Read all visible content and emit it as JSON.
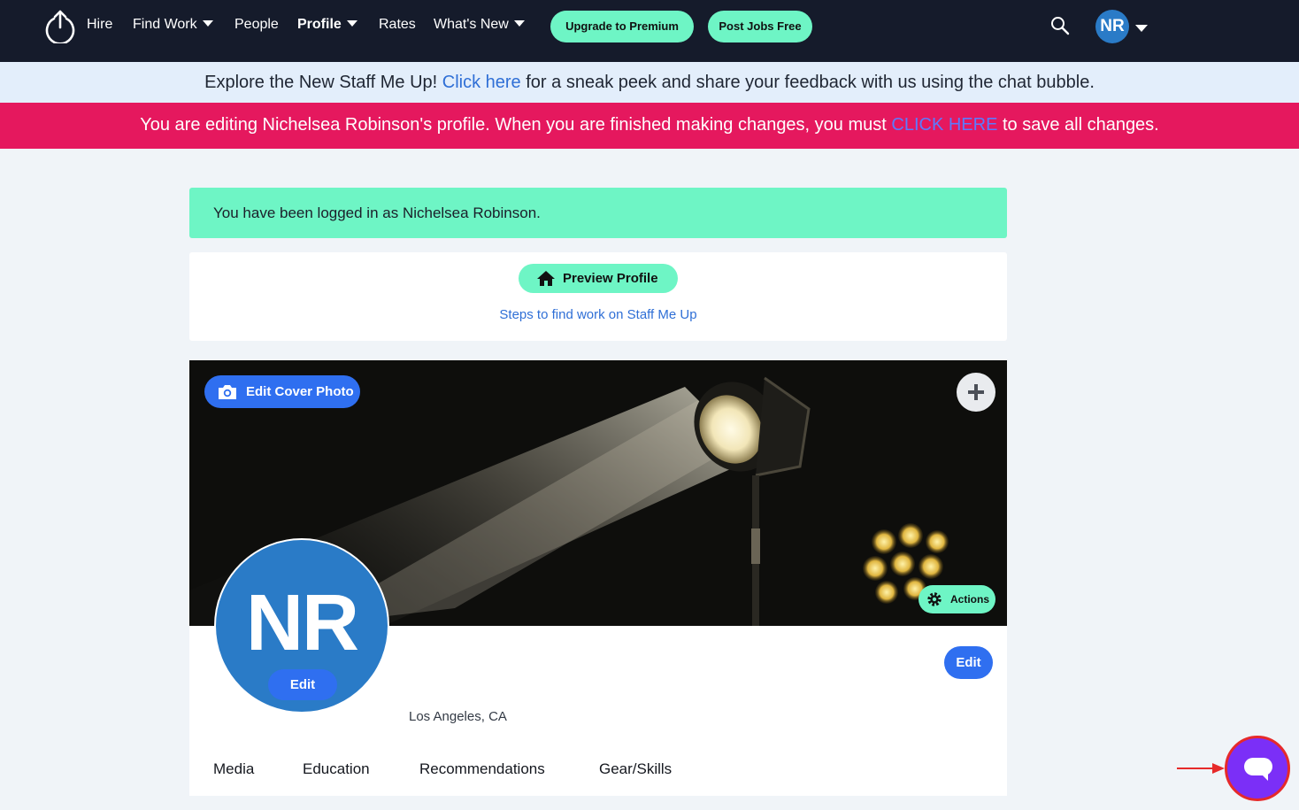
{
  "nav": {
    "items": [
      {
        "label": "Hire"
      },
      {
        "label": "Find Work"
      },
      {
        "label": "People"
      },
      {
        "label": "Profile"
      },
      {
        "label": "Rates"
      },
      {
        "label": "What's New"
      }
    ],
    "upgrade_label": "Upgrade to Premium",
    "post_jobs_label": "Post Jobs Free",
    "avatar_initials": "NR"
  },
  "banner_info": {
    "prefix": "Explore the New Staff Me Up! ",
    "link": "Click here",
    "suffix": " for a sneak peek and share your feedback with us using the chat bubble."
  },
  "banner_edit": {
    "prefix": "You are editing Nichelsea Robinson's profile. When you are finished making changes, you must ",
    "link": "CLICK HERE",
    "suffix": " to save all changes."
  },
  "alert": {
    "text": "You have been logged in as Nichelsea Robinson."
  },
  "profile_actions": {
    "preview_label": "Preview Profile",
    "steps_link": "Steps to find work on Staff Me Up"
  },
  "cover": {
    "edit_cover_label": "Edit Cover Photo",
    "actions_label": "Actions"
  },
  "profile": {
    "initials": "NR",
    "avatar_edit_label": "Edit",
    "edit_label": "Edit",
    "location": "Los Angeles, CA"
  },
  "tabs": [
    {
      "label": "Media"
    },
    {
      "label": "Education"
    },
    {
      "label": "Recommendations"
    },
    {
      "label": "Gear/Skills"
    }
  ],
  "colors": {
    "nav_bg": "#151b2b",
    "accent_green": "#6ef5c5",
    "primary_blue": "#2f6ff0",
    "alert_pink": "#e5185e",
    "chat_purple": "#7b2ff7"
  }
}
